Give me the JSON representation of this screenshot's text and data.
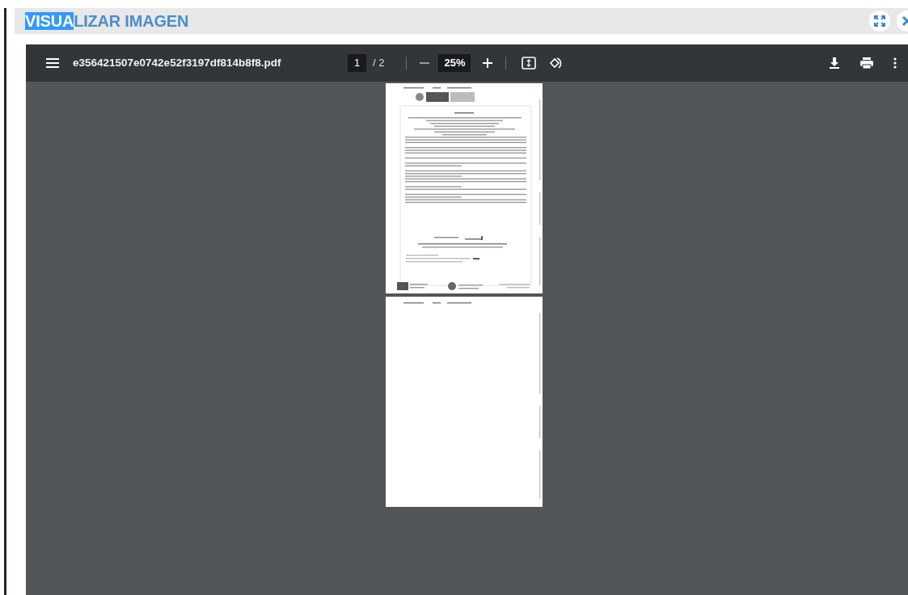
{
  "dialog": {
    "title": [
      {
        "text": "VISUA",
        "selected": true
      },
      {
        "text": "LIZAR IMAGEN",
        "selected": false
      }
    ]
  },
  "viewer": {
    "file_name": "e356421507e0742e52f3197df814b8f8.pdf",
    "page_input": "1",
    "page_total": "/ 2",
    "zoom": "25%"
  },
  "pages": [
    {
      "kind": "letterhead"
    },
    {
      "kind": "continuation"
    }
  ]
}
